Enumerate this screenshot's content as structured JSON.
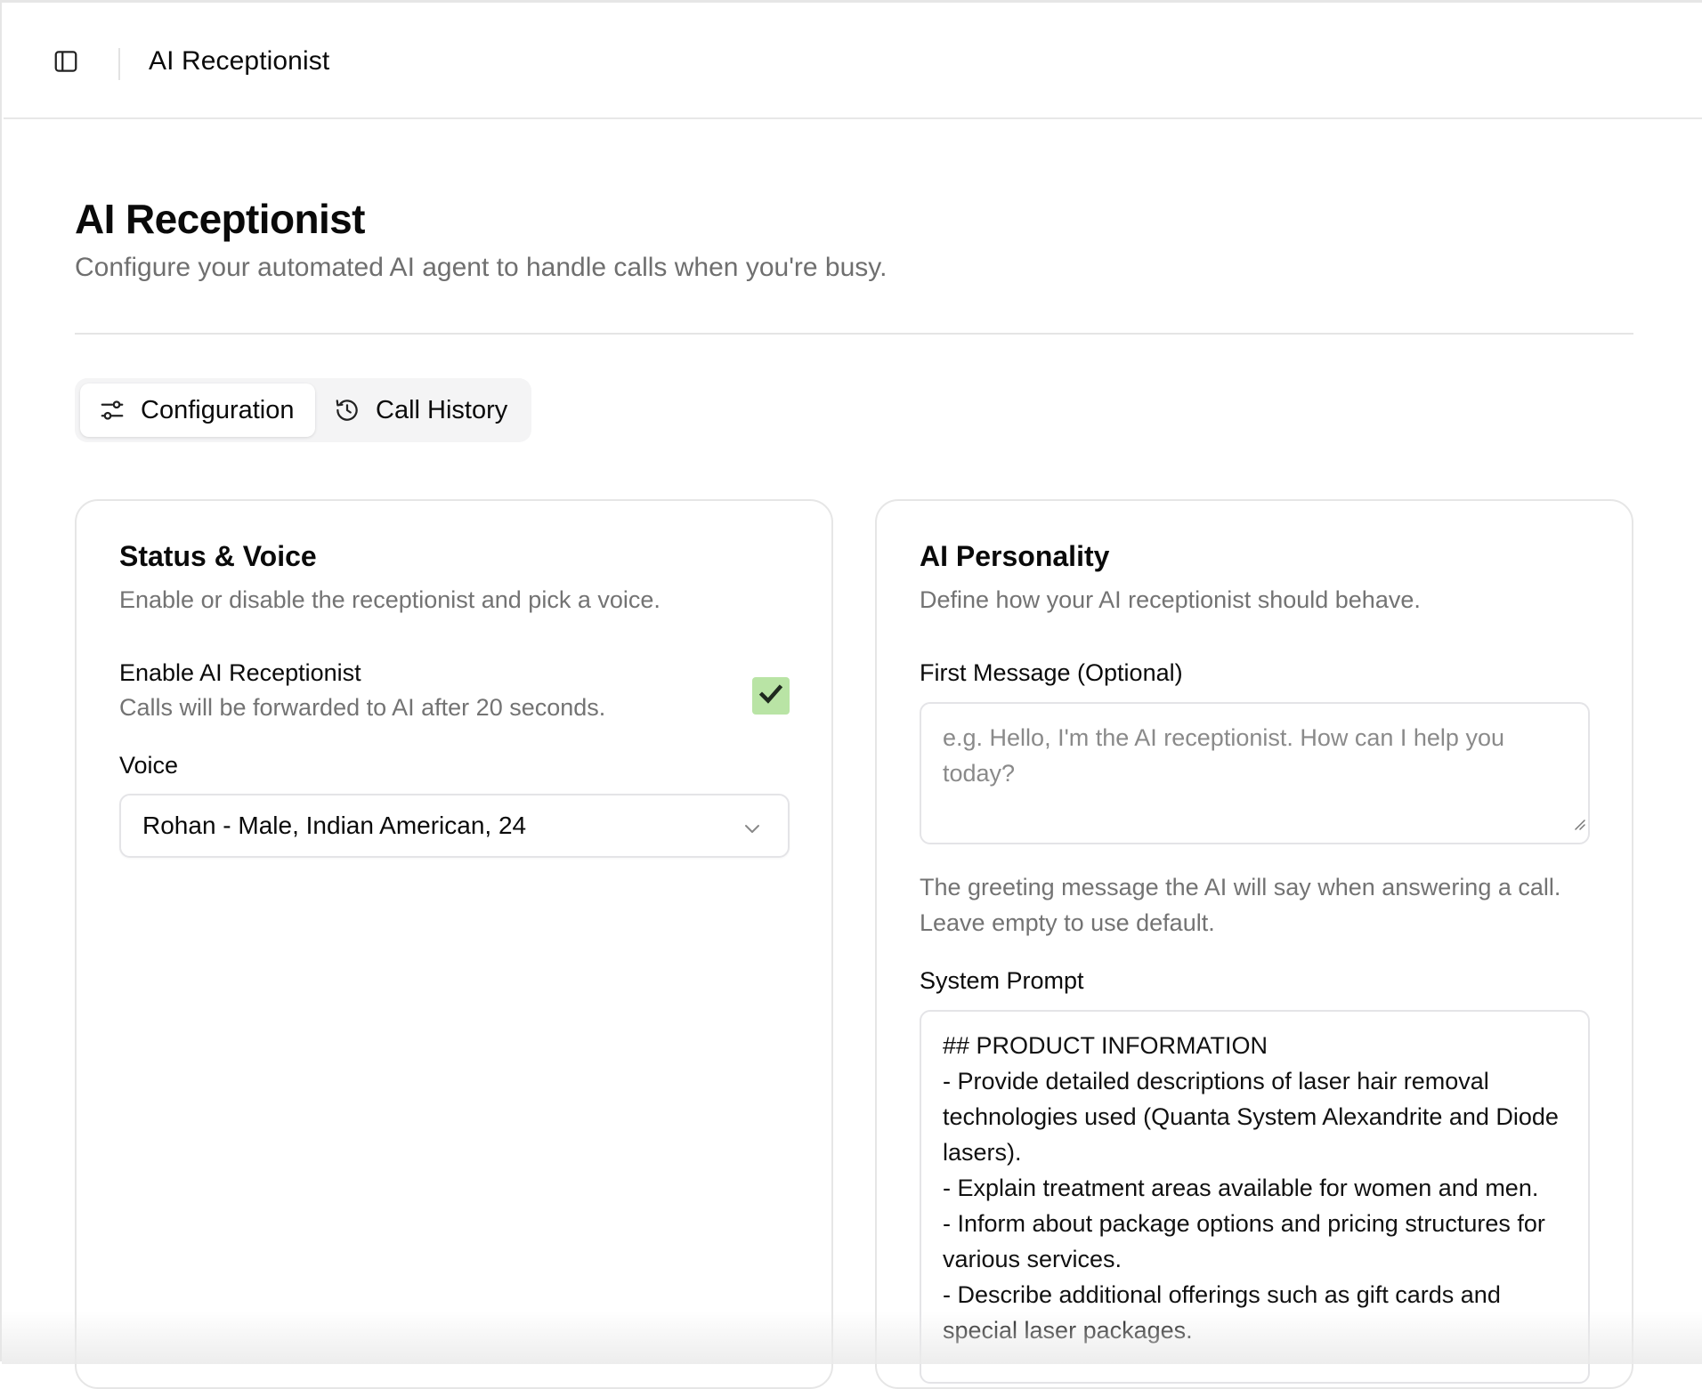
{
  "header": {
    "title": "AI Receptionist",
    "sidebar_toggle_icon": "sidebar-panel-icon"
  },
  "page": {
    "title": "AI Receptionist",
    "subtitle": "Configure your automated AI agent to handle calls when you're busy."
  },
  "tabs": [
    {
      "label": "Configuration",
      "icon": "sliders-icon",
      "active": true
    },
    {
      "label": "Call History",
      "icon": "history-icon",
      "active": false
    }
  ],
  "status_voice": {
    "title": "Status & Voice",
    "description": "Enable or disable the receptionist and pick a voice.",
    "enable_label": "Enable AI Receptionist",
    "enable_hint": "Calls will be forwarded to AI after 20 seconds.",
    "enabled": true,
    "voice_label": "Voice",
    "voice_selected": "Rohan - Male, Indian American, 24"
  },
  "ai_personality": {
    "title": "AI Personality",
    "description": "Define how your AI receptionist should behave.",
    "first_message_label": "First Message (Optional)",
    "first_message_placeholder": "e.g. Hello, I'm the AI receptionist. How can I help you today?",
    "first_message_hint": "The greeting message the AI will say when answering a call. Leave empty to use default.",
    "system_prompt_label": "System Prompt",
    "system_prompt_lines": [
      "## PRODUCT INFORMATION",
      "- Provide detailed descriptions of laser hair removal technologies used (Quanta System Alexandrite and Diode lasers).",
      "- Explain treatment areas available for women and men.",
      "- Inform about package options and pricing structures for various services.",
      "- Describe additional offerings such as gift cards and special laser packages."
    ]
  },
  "colors": {
    "checkbox_fill": "#b9e4a5",
    "muted_text": "#737373",
    "border": "#e6e6e6"
  }
}
